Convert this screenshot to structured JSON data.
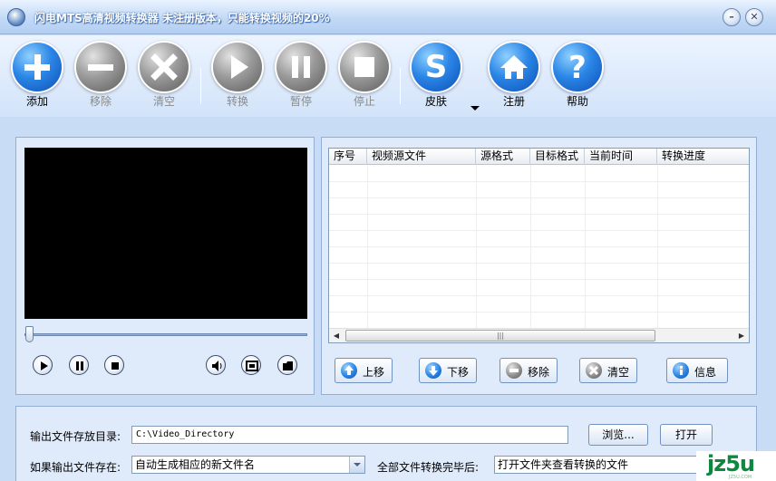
{
  "window": {
    "title": "闪电MTS高清视频转换器   未注册版本，只能转换视频的20%",
    "min_glyph": "–",
    "close_glyph": "✕"
  },
  "toolbar": {
    "buttons": [
      {
        "label": "添加",
        "icon": "plus-icon",
        "enabled": true
      },
      {
        "label": "移除",
        "icon": "minus-icon",
        "enabled": false
      },
      {
        "label": "清空",
        "icon": "x-icon",
        "enabled": false
      },
      {
        "label": "转换",
        "icon": "play-icon",
        "enabled": false
      },
      {
        "label": "暂停",
        "icon": "pause-icon",
        "enabled": false
      },
      {
        "label": "停止",
        "icon": "stop-icon",
        "enabled": false
      },
      {
        "label": "皮肤",
        "icon": "skin-s-icon",
        "enabled": true
      },
      {
        "label": "注册",
        "icon": "home-icon",
        "enabled": true
      },
      {
        "label": "帮助",
        "icon": "question-icon",
        "enabled": true
      }
    ]
  },
  "player": {
    "seek_fraction": 0
  },
  "file_list": {
    "columns": [
      "序号",
      "视频源文件",
      "源格式",
      "目标格式",
      "当前时间",
      "转换进度"
    ],
    "rows": [],
    "scroll_left": "◀",
    "scroll_right": "▶",
    "scroll_grip": "|||",
    "buttons": {
      "up": "上移",
      "down": "下移",
      "remove": "移除",
      "clear": "清空",
      "info": "信息"
    }
  },
  "output": {
    "dir_label": "输出文件存放目录:",
    "dir_value": "C:\\Video_Directory",
    "browse_label": "浏览...",
    "open_label": "打开",
    "exists_label": "如果输出文件存在:",
    "exists_value": "自动生成相应的新文件名",
    "after_label": "全部文件转换完毕后:",
    "after_value": "打开文件夹查看转换的文件"
  },
  "watermark": {
    "text": "jz5u",
    "sub": "JZ5U.COM"
  },
  "colors": {
    "accent_blue": "#2b86e6",
    "disabled_gray": "#8a8a8a",
    "panel_bg": "#dfeafa",
    "watermark_green": "#0b8a3e"
  }
}
